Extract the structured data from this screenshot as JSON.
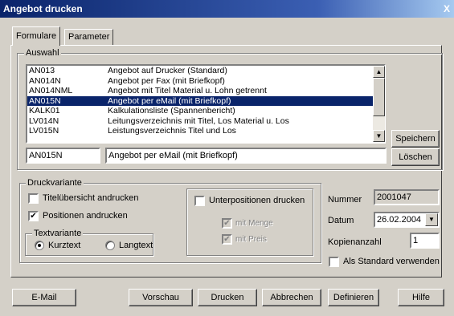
{
  "window": {
    "title": "Angebot drucken",
    "close_label": "X"
  },
  "tabs": [
    {
      "label": "Formulare",
      "active": true
    },
    {
      "label": "Parameter",
      "active": false
    }
  ],
  "auswahl": {
    "legend": "Auswahl",
    "items": [
      {
        "code": "AN013",
        "desc": "Angebot auf Drucker (Standard)"
      },
      {
        "code": "AN014N",
        "desc": "Angebot per Fax (mit Briefkopf)"
      },
      {
        "code": "AN014NML",
        "desc": "Angebot mit Titel Material u. Lohn getrennt"
      },
      {
        "code": "AN015N",
        "desc": "Angebot per eMail (mit Briefkopf)"
      },
      {
        "code": "KALK01",
        "desc": "Kalkulationsliste (Spannenbericht)"
      },
      {
        "code": "LV014N",
        "desc": "Leitungsverzeichnis mit Titel, Los Material u. Los"
      },
      {
        "code": "LV015N",
        "desc": "Leistungsverzeichnis Titel und Los"
      }
    ],
    "selected_index": 3,
    "code_value": "AN015N",
    "desc_value": "Angebot per eMail (mit Briefkopf)",
    "save_label": "Speichern",
    "delete_label": "Löschen"
  },
  "druckvariante": {
    "legend": "Druckvariante",
    "titel_label": "Titelübersicht andrucken",
    "titel_checked": false,
    "positionen_label": "Positionen andrucken",
    "positionen_checked": true,
    "textvariante_legend": "Textvariante",
    "kurztext_label": "Kurztext",
    "langtext_label": "Langtext",
    "selected": "Kurztext",
    "unterpos_label": "Unterpositionen drucken",
    "unterpos_checked": false,
    "menge_label": "mit Menge",
    "preis_label": "mit Preis"
  },
  "info": {
    "nummer_label": "Nummer",
    "nummer_value": "2001047",
    "datum_label": "Datum",
    "datum_value": "26.02.2004",
    "kopien_label": "Kopienanzahl",
    "kopien_value": "1",
    "standard_label": "Als Standard verwenden"
  },
  "buttons": {
    "email": "E-Mail",
    "vorschau": "Vorschau",
    "drucken": "Drucken",
    "abbrechen": "Abbrechen",
    "definieren": "Definieren",
    "hilfe": "Hilfe"
  },
  "icons": {
    "check": "✔",
    "arrow_up": "▲",
    "arrow_down": "▼"
  }
}
